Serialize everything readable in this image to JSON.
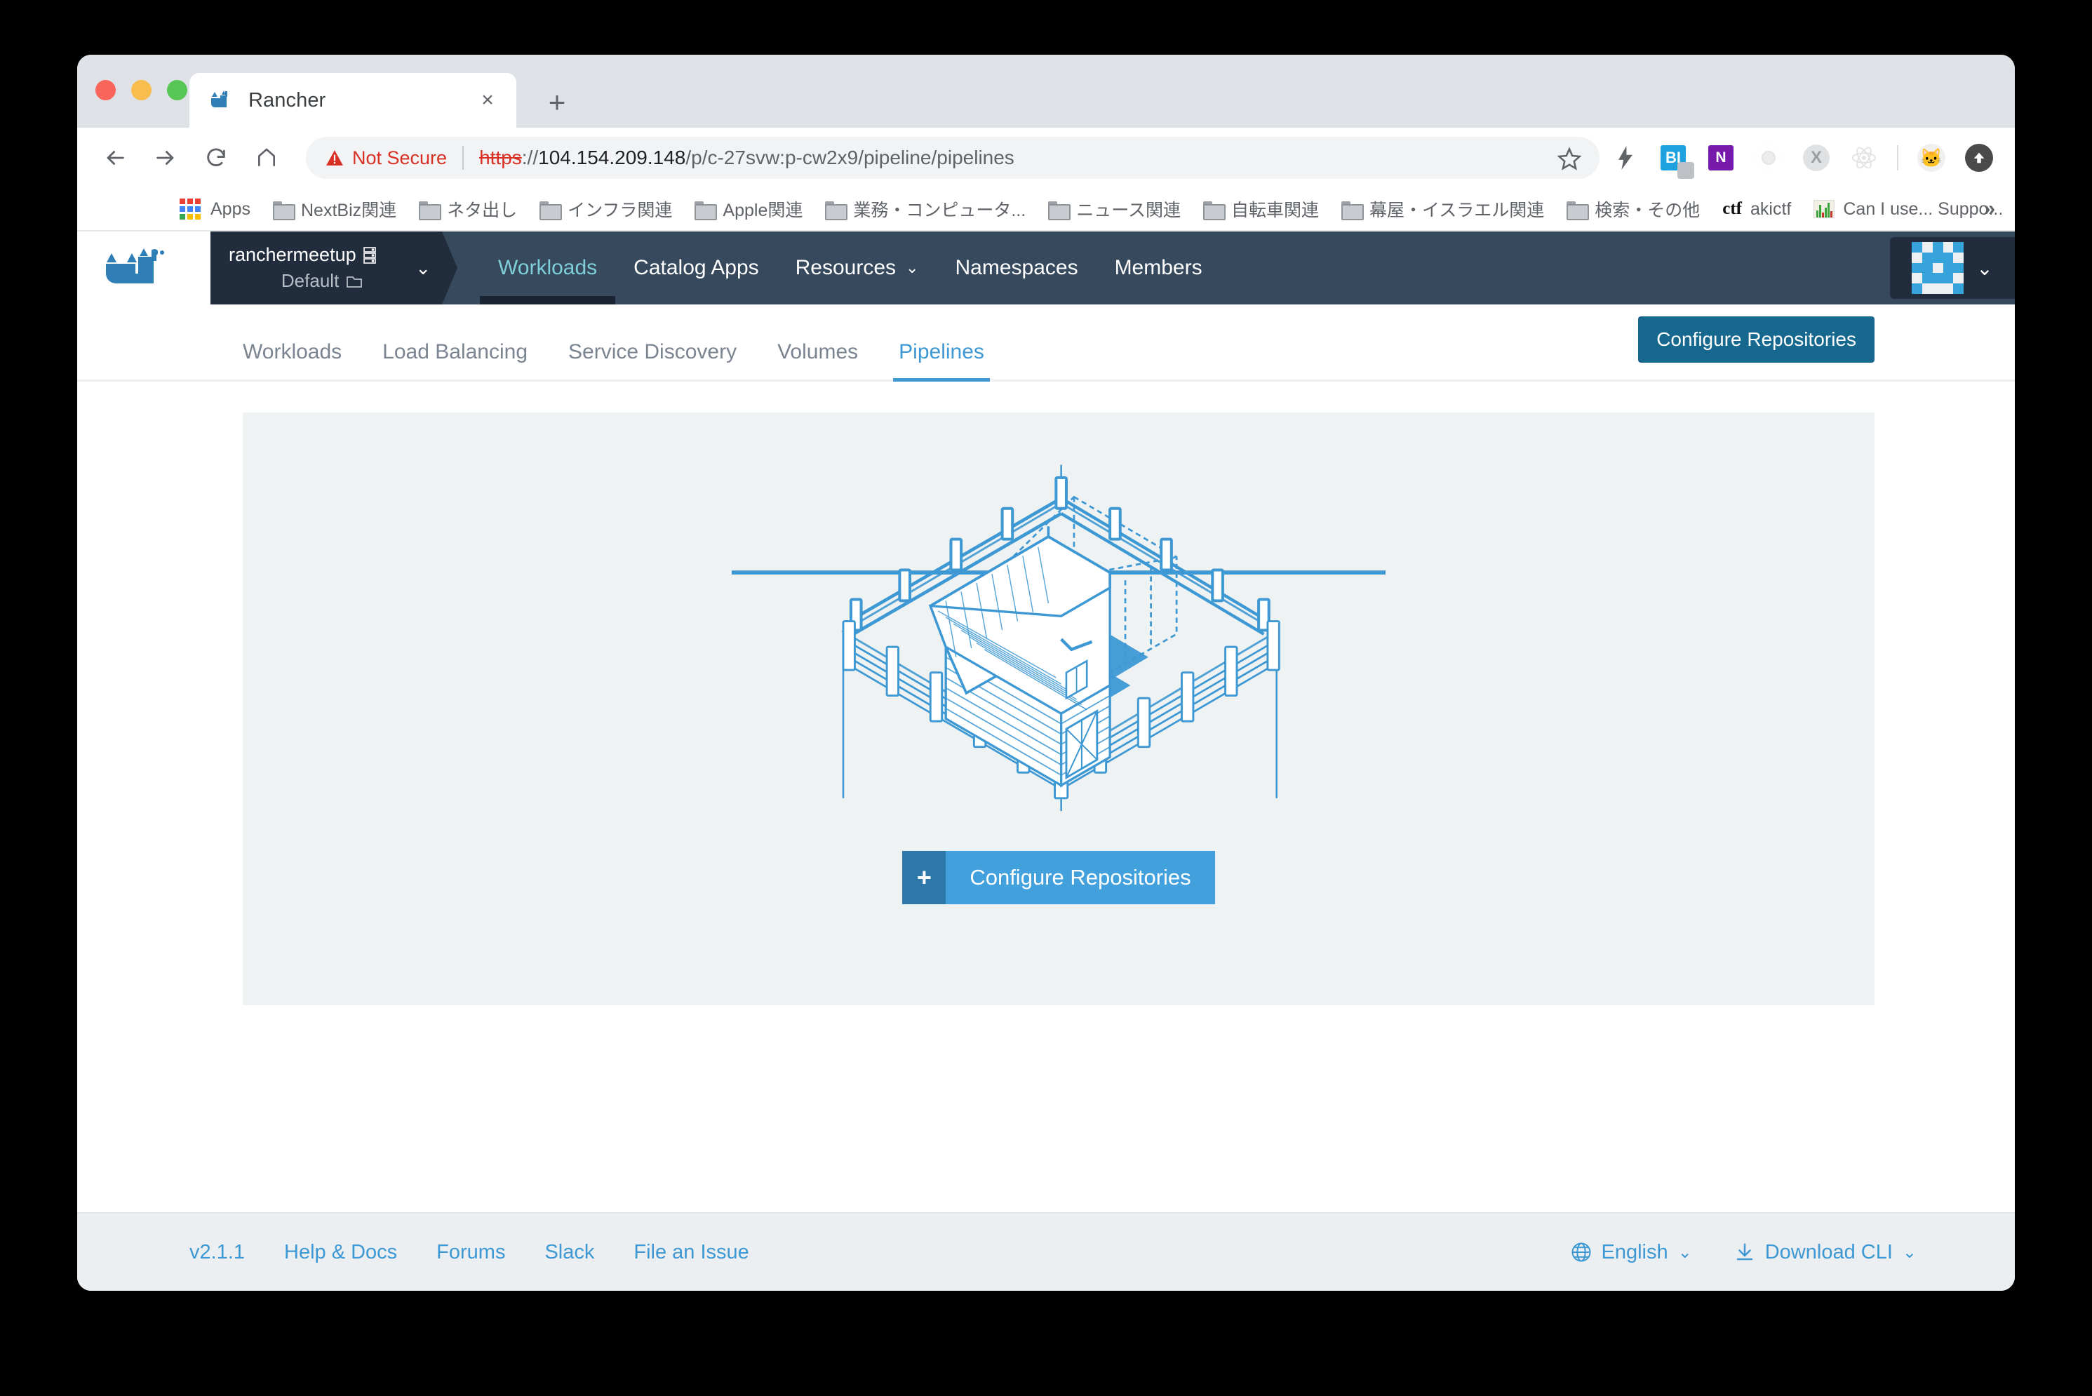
{
  "browser": {
    "tab": {
      "title": "Rancher",
      "favicon": "rancher-cow-icon",
      "close": "×"
    },
    "new_tab": "+",
    "nav": {
      "back": "←",
      "forward": "→",
      "reload": "⟳",
      "home": "⌂"
    },
    "omnibox": {
      "security_label": "Not Secure",
      "url_scheme": "https",
      "url_colon": "://",
      "url_host": "104.154.209.148",
      "url_path": "/p/c-27svw:p-cw2x9/pipeline/pipelines",
      "bookmark_star": "☆"
    },
    "extensions": [
      {
        "name": "lightning-icon",
        "glyph": "⚡"
      },
      {
        "name": "bi-extension-icon",
        "glyph": "BI"
      },
      {
        "name": "onenote-extension-icon",
        "glyph": "N"
      },
      {
        "name": "ring-extension-icon",
        "glyph": ""
      },
      {
        "name": "x-extension-icon",
        "glyph": "X"
      },
      {
        "name": "react-devtools-icon",
        "glyph": "⚛"
      },
      {
        "name": "profile-avatar-icon",
        "glyph": "🐱"
      },
      {
        "name": "upload-icon",
        "glyph": "⬆"
      }
    ],
    "bookmarks": [
      {
        "label": "Apps",
        "icon": "apps-grid-icon"
      },
      {
        "label": "NextBiz関連",
        "icon": "folder-icon"
      },
      {
        "label": "ネタ出し",
        "icon": "folder-icon"
      },
      {
        "label": "インフラ関連",
        "icon": "folder-icon"
      },
      {
        "label": "Apple関連",
        "icon": "folder-icon"
      },
      {
        "label": "業務・コンピュータ...",
        "icon": "folder-icon"
      },
      {
        "label": "ニュース関連",
        "icon": "folder-icon"
      },
      {
        "label": "自転車関連",
        "icon": "folder-icon"
      },
      {
        "label": "幕屋・イスラエル関連",
        "icon": "folder-icon"
      },
      {
        "label": "検索・その他",
        "icon": "folder-icon"
      },
      {
        "label": "akictf",
        "icon": "ctf-icon"
      },
      {
        "label": "Can I use... Suppo...",
        "icon": "caniuse-icon"
      }
    ],
    "bookmarks_overflow": "»"
  },
  "rancher": {
    "logo": "rancher-cow-logo",
    "cluster": {
      "name": "ranchermeetup",
      "project": "Default",
      "caret": "⌄"
    },
    "nav_items": [
      {
        "label": "Workloads",
        "active": true,
        "caret": ""
      },
      {
        "label": "Catalog Apps",
        "active": false,
        "caret": ""
      },
      {
        "label": "Resources",
        "active": false,
        "caret": "⌄"
      },
      {
        "label": "Namespaces",
        "active": false,
        "caret": ""
      },
      {
        "label": "Members",
        "active": false,
        "caret": ""
      }
    ],
    "user_menu": {
      "avatar": "identicon-avatar",
      "caret": "⌄"
    },
    "identicon": {
      "color_on": "#36a4da",
      "color_off": "#eeeff0",
      "grid": [
        [
          1,
          0,
          1,
          0,
          1
        ],
        [
          0,
          1,
          1,
          1,
          0
        ],
        [
          1,
          1,
          0,
          1,
          1
        ],
        [
          0,
          1,
          1,
          1,
          0
        ],
        [
          1,
          0,
          0,
          0,
          1
        ]
      ]
    },
    "subtabs": [
      {
        "label": "Workloads",
        "active": false
      },
      {
        "label": "Load Balancing",
        "active": false
      },
      {
        "label": "Service Discovery",
        "active": false
      },
      {
        "label": "Volumes",
        "active": false
      },
      {
        "label": "Pipelines",
        "active": true
      }
    ],
    "configure_top_button": "Configure Repositories",
    "empty_state": {
      "illustration": "isometric-barn-illustration",
      "button_plus": "+",
      "button_label": "Configure Repositories"
    },
    "footer": {
      "version": "v2.1.1",
      "links": [
        "Help & Docs",
        "Forums",
        "Slack",
        "File an Issue"
      ],
      "language": "English",
      "language_caret": "⌄",
      "download_cli": "Download CLI",
      "download_caret": "⌄"
    },
    "colors": {
      "accent_blue": "#3d98d3",
      "nav_dark": "#37495c",
      "cluster_dark": "#212c3c",
      "active_teal": "#7ecfda",
      "panel_bg": "#eef2f3",
      "button_dark_blue": "#16688e",
      "button_light_blue": "#42a0dd"
    }
  }
}
